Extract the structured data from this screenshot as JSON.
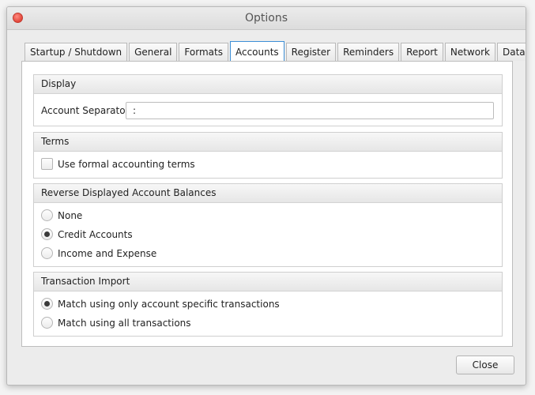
{
  "window": {
    "title": "Options"
  },
  "tabs": [
    {
      "label": "Startup / Shutdown"
    },
    {
      "label": "General"
    },
    {
      "label": "Formats"
    },
    {
      "label": "Accounts",
      "active": true
    },
    {
      "label": "Register"
    },
    {
      "label": "Reminders"
    },
    {
      "label": "Report"
    },
    {
      "label": "Network"
    },
    {
      "label": "Data Providers"
    }
  ],
  "display": {
    "header": "Display",
    "separator_label": "Account Separator:",
    "separator_value": ":"
  },
  "terms": {
    "header": "Terms",
    "formal_label": "Use formal accounting terms",
    "formal_checked": false
  },
  "balances": {
    "header": "Reverse Displayed Account Balances",
    "options": [
      {
        "label": "None",
        "checked": false
      },
      {
        "label": "Credit Accounts",
        "checked": true
      },
      {
        "label": "Income and Expense",
        "checked": false
      }
    ]
  },
  "import": {
    "header": "Transaction Import",
    "options": [
      {
        "label": "Match using only account specific transactions",
        "checked": true
      },
      {
        "label": "Match using all transactions",
        "checked": false
      }
    ]
  },
  "footer": {
    "close_label": "Close"
  }
}
